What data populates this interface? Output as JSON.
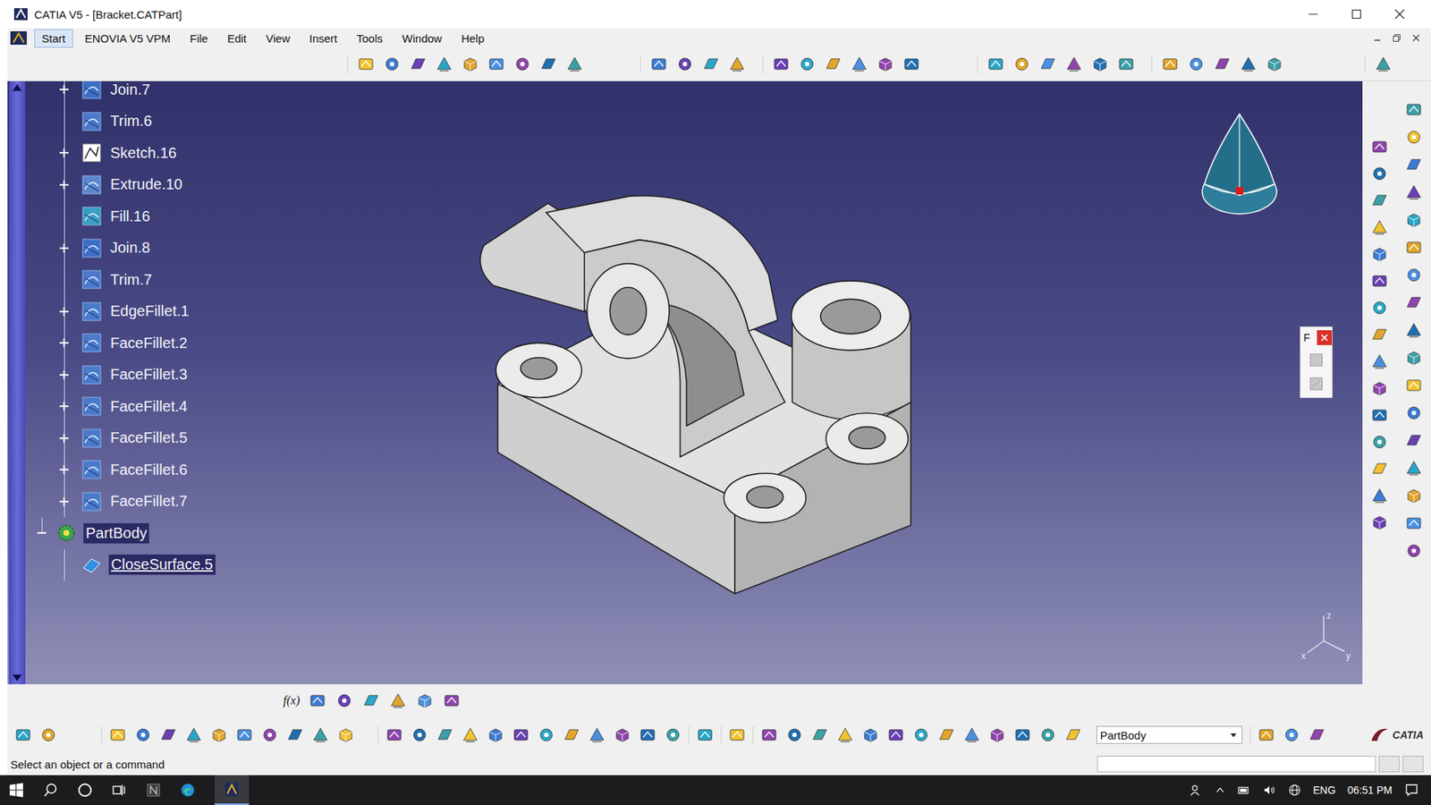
{
  "window": {
    "title": "CATIA V5 - [Bracket.CATPart]"
  },
  "menu": [
    {
      "label": "Start",
      "selected": true
    },
    {
      "label": "ENOVIA V5 VPM",
      "selected": false
    },
    {
      "label": "File",
      "selected": false
    },
    {
      "label": "Edit",
      "selected": false
    },
    {
      "label": "View",
      "selected": false
    },
    {
      "label": "Insert",
      "selected": false
    },
    {
      "label": "Tools",
      "selected": false
    },
    {
      "label": "Window",
      "selected": false
    },
    {
      "label": "Help",
      "selected": false
    }
  ],
  "tree": [
    {
      "label": "Join.7",
      "kind": "join",
      "level": 1,
      "expandable": true,
      "expanded": false,
      "highlighted": false,
      "underlined": false
    },
    {
      "label": "Trim.6",
      "kind": "trim",
      "level": 1,
      "expandable": false,
      "expanded": false,
      "highlighted": false,
      "underlined": false
    },
    {
      "label": "Sketch.16",
      "kind": "sketch",
      "level": 1,
      "expandable": true,
      "expanded": false,
      "highlighted": false,
      "underlined": false
    },
    {
      "label": "Extrude.10",
      "kind": "extrude",
      "level": 1,
      "expandable": true,
      "expanded": false,
      "highlighted": false,
      "underlined": false
    },
    {
      "label": "Fill.16",
      "kind": "fill",
      "level": 1,
      "expandable": false,
      "expanded": false,
      "highlighted": false,
      "underlined": false
    },
    {
      "label": "Join.8",
      "kind": "join",
      "level": 1,
      "expandable": true,
      "expanded": false,
      "highlighted": false,
      "underlined": false
    },
    {
      "label": "Trim.7",
      "kind": "trim",
      "level": 1,
      "expandable": false,
      "expanded": false,
      "highlighted": false,
      "underlined": false
    },
    {
      "label": "EdgeFillet.1",
      "kind": "fillet",
      "level": 1,
      "expandable": true,
      "expanded": false,
      "highlighted": false,
      "underlined": false
    },
    {
      "label": "FaceFillet.2",
      "kind": "fillet",
      "level": 1,
      "expandable": true,
      "expanded": false,
      "highlighted": false,
      "underlined": false
    },
    {
      "label": "FaceFillet.3",
      "kind": "fillet",
      "level": 1,
      "expandable": true,
      "expanded": false,
      "highlighted": false,
      "underlined": false
    },
    {
      "label": "FaceFillet.4",
      "kind": "fillet",
      "level": 1,
      "expandable": true,
      "expanded": false,
      "highlighted": false,
      "underlined": false
    },
    {
      "label": "FaceFillet.5",
      "kind": "fillet",
      "level": 1,
      "expandable": true,
      "expanded": false,
      "highlighted": false,
      "underlined": false
    },
    {
      "label": "FaceFillet.6",
      "kind": "fillet",
      "level": 1,
      "expandable": true,
      "expanded": false,
      "highlighted": false,
      "underlined": false
    },
    {
      "label": "FaceFillet.7",
      "kind": "fillet",
      "level": 1,
      "expandable": true,
      "expanded": false,
      "highlighted": false,
      "underlined": false
    },
    {
      "label": "PartBody",
      "kind": "body",
      "level": 0,
      "expandable": true,
      "expanded": true,
      "highlighted": true,
      "underlined": false
    },
    {
      "label": "CloseSurface.5",
      "kind": "closesurface",
      "level": 1,
      "expandable": false,
      "expanded": false,
      "highlighted": true,
      "underlined": true
    }
  ],
  "viewport": {
    "axis_labels": [
      "z",
      "x",
      "y"
    ],
    "floating_toolbar": {
      "title": "F"
    }
  },
  "bottom_toolbar": {
    "formula_label": "f(x)"
  },
  "body_selector": {
    "value": "PartBody"
  },
  "status_bar": {
    "message": "Select an object or a command"
  },
  "logo": {
    "text": "CATIA"
  },
  "taskbar": {
    "language": "ENG",
    "time": "06:51 PM"
  }
}
